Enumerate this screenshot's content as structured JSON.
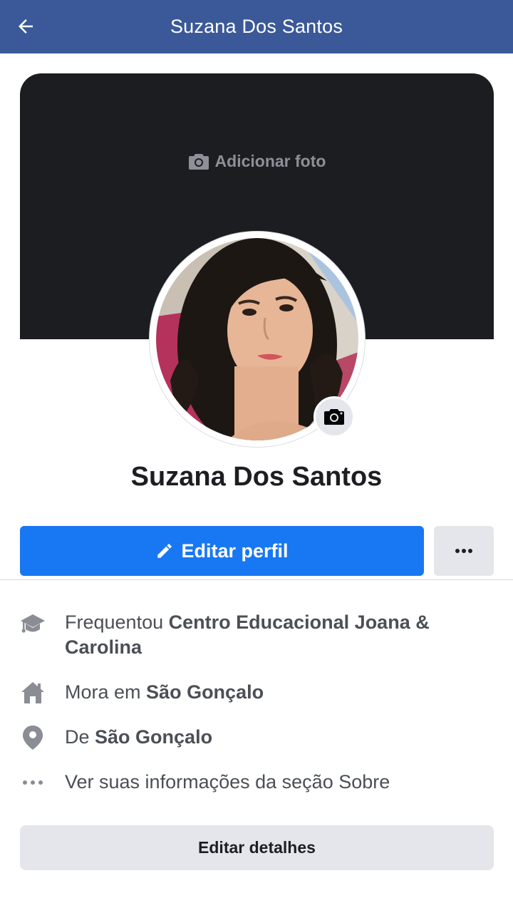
{
  "header": {
    "title": "Suzana Dos Santos",
    "back_icon": "arrow-left-icon",
    "background_color": "#3b5998"
  },
  "cover": {
    "add_photo_label": "Adicionar foto",
    "icon": "camera-icon",
    "background_color": "#1c1d21"
  },
  "profile": {
    "name": "Suzana Dos Santos",
    "avatar_badge_icon": "camera-icon"
  },
  "actions": {
    "edit_profile_label": "Editar perfil",
    "edit_icon": "pencil-icon",
    "more_icon": "more-dots-icon",
    "primary_color": "#1877f2"
  },
  "info": {
    "school": {
      "icon": "graduation-cap-icon",
      "prefix": "Frequentou",
      "value": "Centro Educacional Joana & Carolina"
    },
    "lives": {
      "icon": "home-icon",
      "prefix": "Mora em",
      "value": "São Gonçalo"
    },
    "from": {
      "icon": "location-pin-icon",
      "prefix": "De",
      "value": "São Gonçalo"
    },
    "about": {
      "icon": "more-dots-icon",
      "text": "Ver suas informações da seção Sobre"
    }
  },
  "edit_details_label": "Editar detalhes"
}
